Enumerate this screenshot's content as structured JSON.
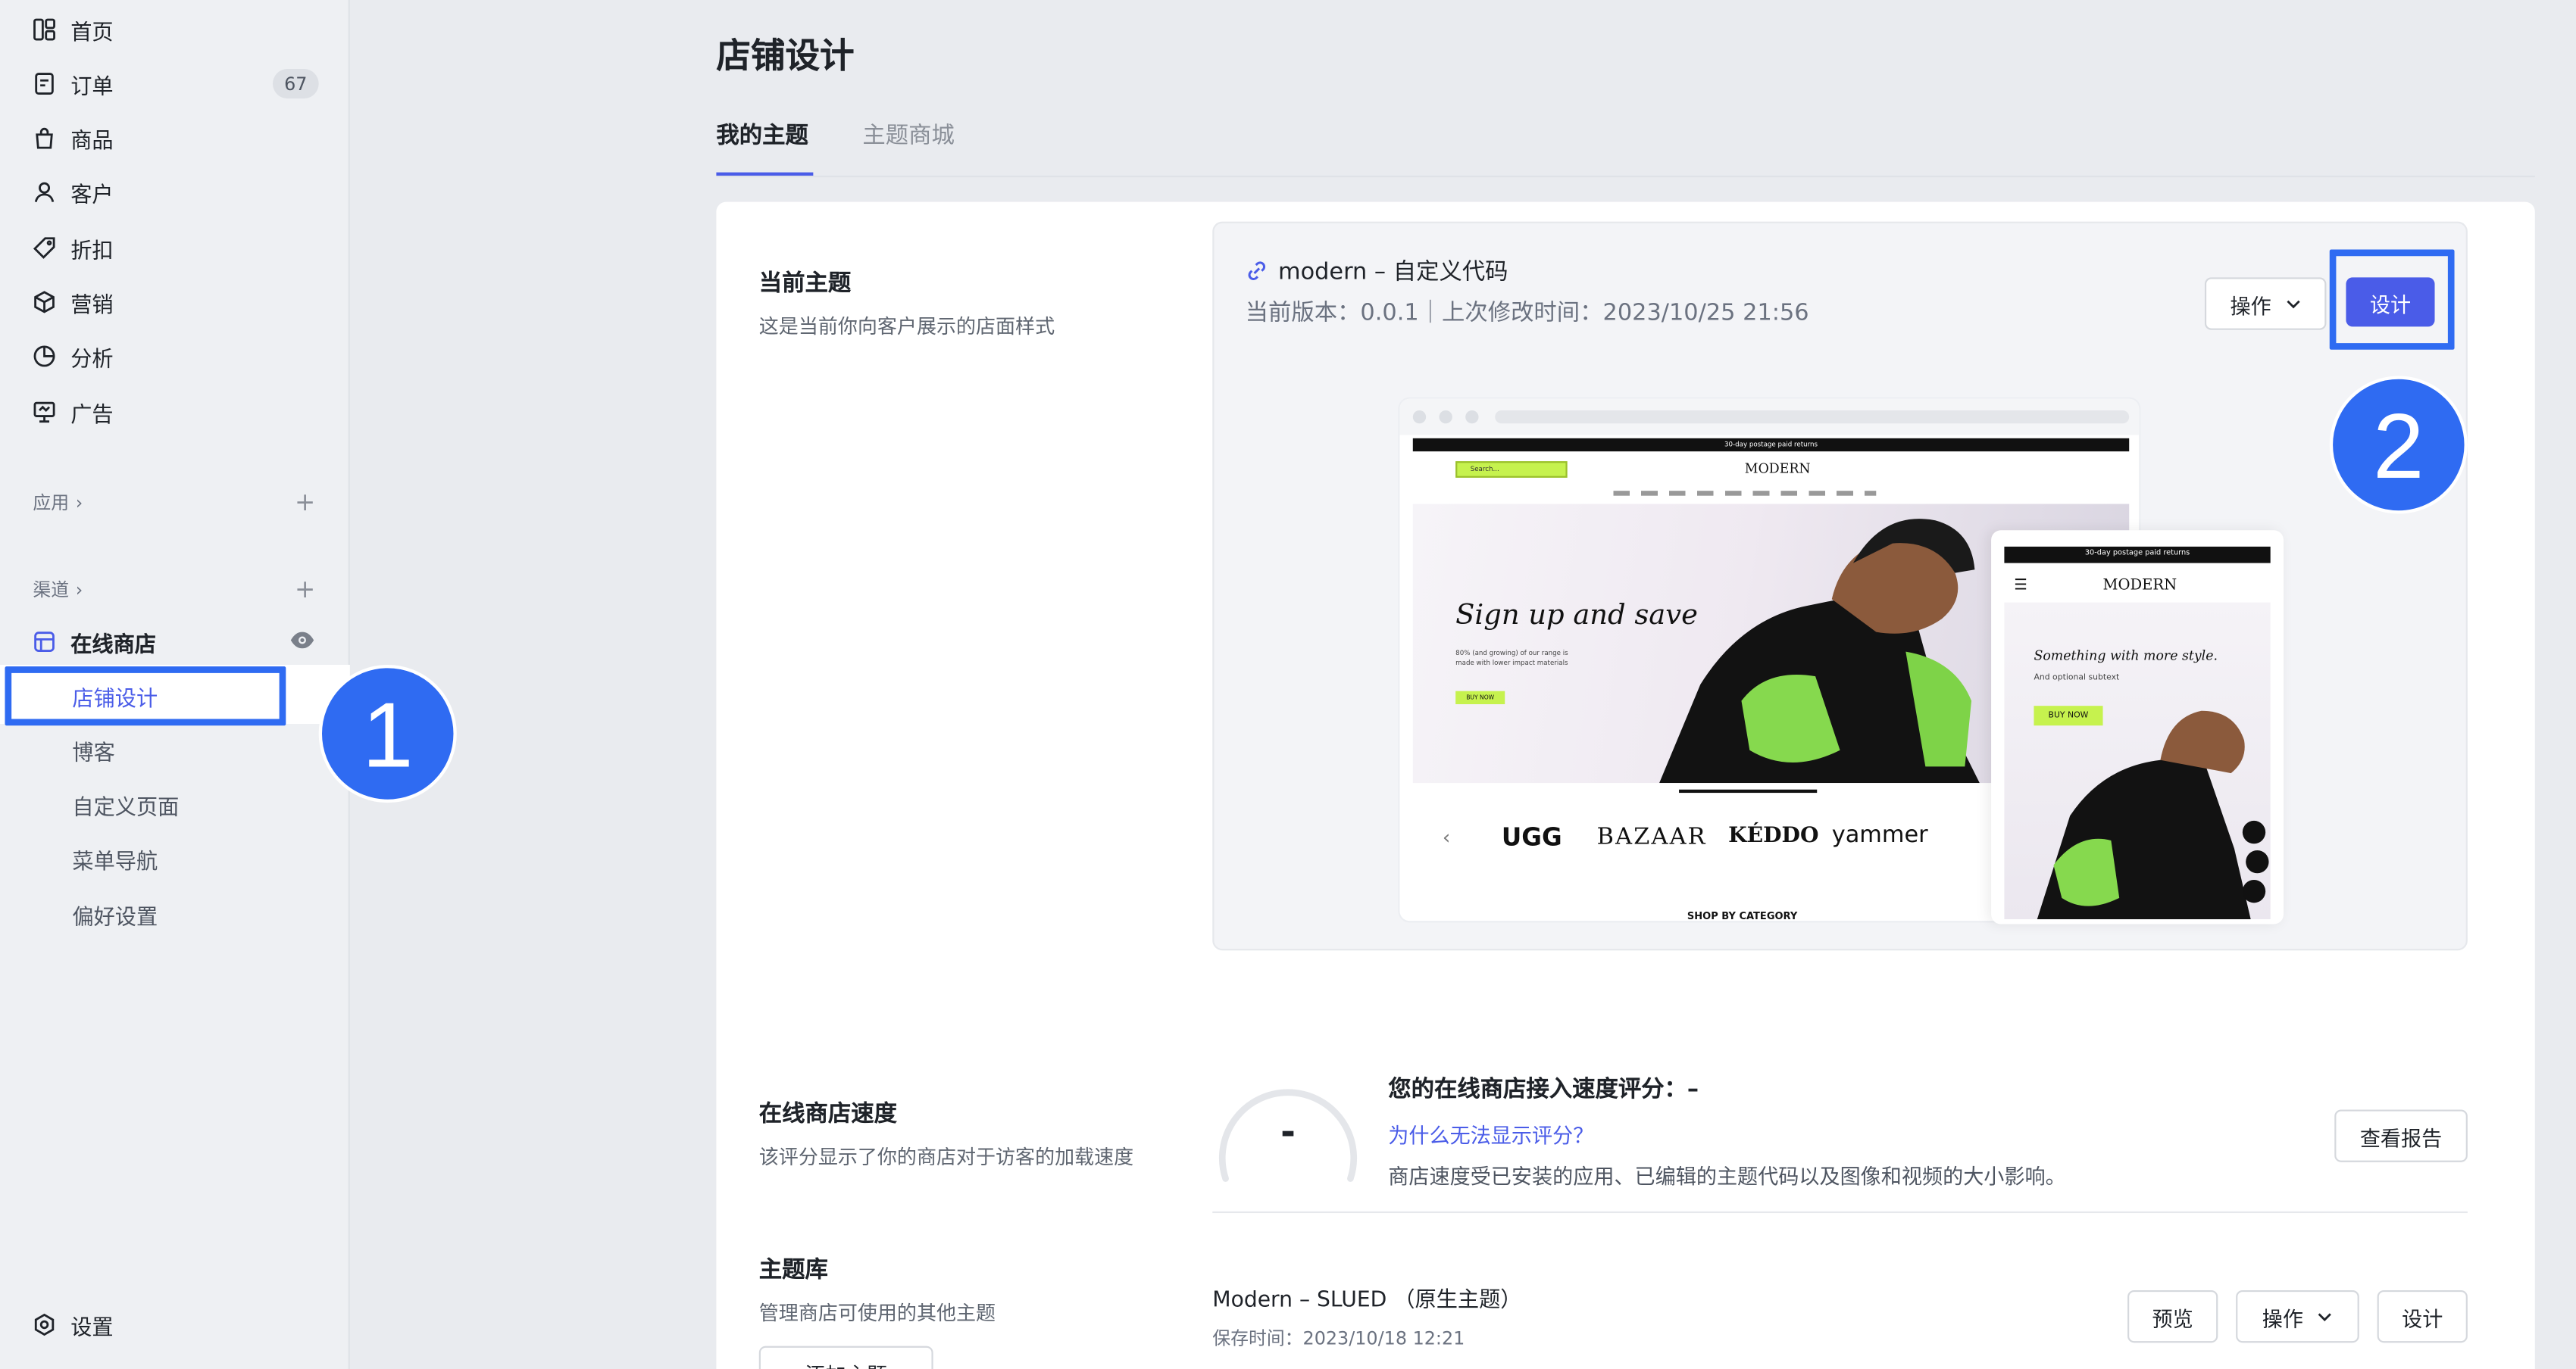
{
  "sidebar": {
    "items": [
      {
        "label": "首页",
        "icon": "dashboard-icon"
      },
      {
        "label": "订单",
        "icon": "order-icon",
        "badge": "67"
      },
      {
        "label": "商品",
        "icon": "bag-icon"
      },
      {
        "label": "客户",
        "icon": "person-icon"
      },
      {
        "label": "折扣",
        "icon": "tag-icon"
      },
      {
        "label": "营销",
        "icon": "cube-icon"
      },
      {
        "label": "分析",
        "icon": "pie-chart-icon"
      },
      {
        "label": "广告",
        "icon": "megaphone-icon"
      }
    ],
    "apps_label": "应用",
    "channels_label": "渠道",
    "online_store_label": "在线商店",
    "sub_items": [
      "店铺设计",
      "博客",
      "自定义页面",
      "菜单导航",
      "偏好设置"
    ],
    "settings_label": "设置"
  },
  "markers": {
    "one": "1",
    "two": "2"
  },
  "page": {
    "title": "店铺设计",
    "tabs": [
      "我的主题",
      "主题商城"
    ]
  },
  "current_theme": {
    "section_title": "当前主题",
    "section_desc": "这是当前你向客户展示的店面样式",
    "name": "modern – 自定义代码",
    "meta": "当前版本：0.0.1｜上次修改时间：2023/10/25 21:56",
    "actions_label": "操作",
    "design_label": "设计"
  },
  "preview": {
    "promo_bar": "30-day postage paid returns",
    "search_placeholder": "Search...",
    "brand": "MODERN",
    "hero_title": "Sign up and save",
    "hero_body": "80% (and growing) of our range is made with lower impact materials",
    "hero_cta": "BUY NOW",
    "brands": [
      "UGG",
      "BAZAAR",
      "KÉDDO",
      "yammer"
    ],
    "category_heading": "SHOP BY CATEGORY",
    "mobile_promo": "30-day postage paid returns",
    "mobile_title": "Something with more style.",
    "mobile_subtitle": "And optional subtext",
    "mobile_cta": "BUY NOW"
  },
  "speed": {
    "section_title": "在线商店速度",
    "section_desc": "该评分显示了你的商店对于访客的加载速度",
    "score": "-",
    "title": "您的在线商店接入速度评分：–",
    "link": "为什么无法显示评分？",
    "note": "商店速度受已安装的应用、已编辑的主题代码以及图像和视频的大小影响。",
    "report_label": "查看报告"
  },
  "library": {
    "section_title": "主题库",
    "section_desc": "管理商店可使用的其他主题",
    "add_label": "添加主题",
    "theme_name": "Modern – SLUED （原生主题）",
    "saved_time": "保存时间：2023/10/18 12:21",
    "preview_label": "预览",
    "actions_label": "操作",
    "design_label": "设计"
  },
  "colors": {
    "accent": "#4a5ce8",
    "annotation": "#2f6bf2",
    "hero_green": "#c6f24e"
  }
}
